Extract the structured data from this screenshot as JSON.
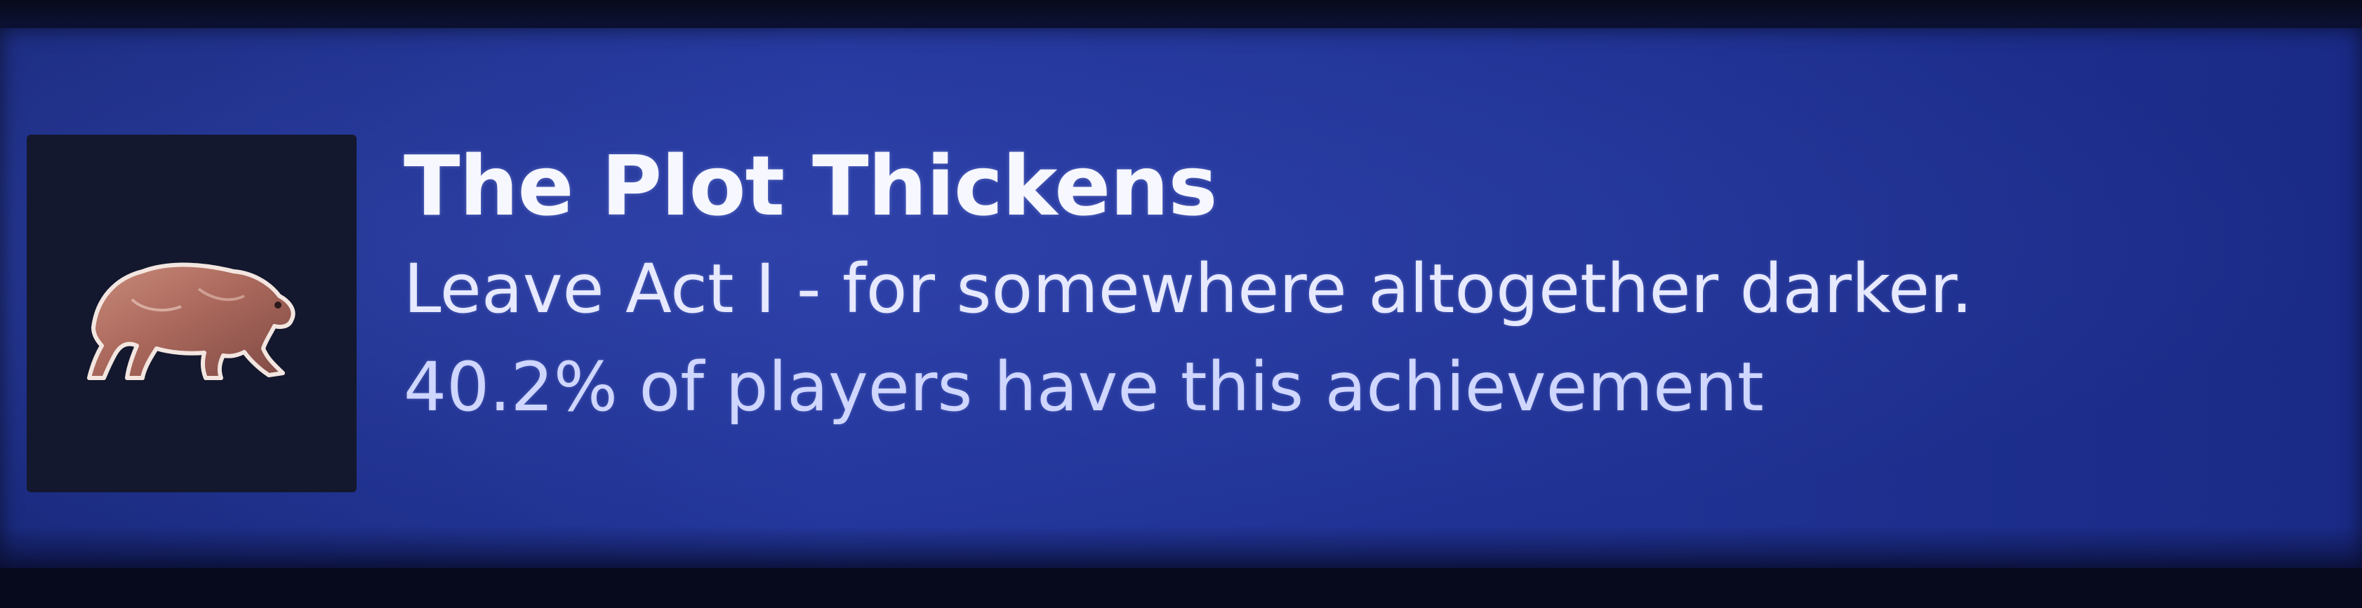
{
  "achievement": {
    "title": "The Plot Thickens",
    "description": "Leave Act I - for somewhere altogether darker.",
    "rarity_text": "40.2% of players have this achievement",
    "rarity_percent": 40.2,
    "icon": "bear-icon"
  },
  "colors": {
    "panel_bg": "#22359a",
    "icon_bg": "#13182e",
    "icon_fill": "#b9786a",
    "icon_outline": "#f3e6e0",
    "text": "#eef0ff"
  }
}
